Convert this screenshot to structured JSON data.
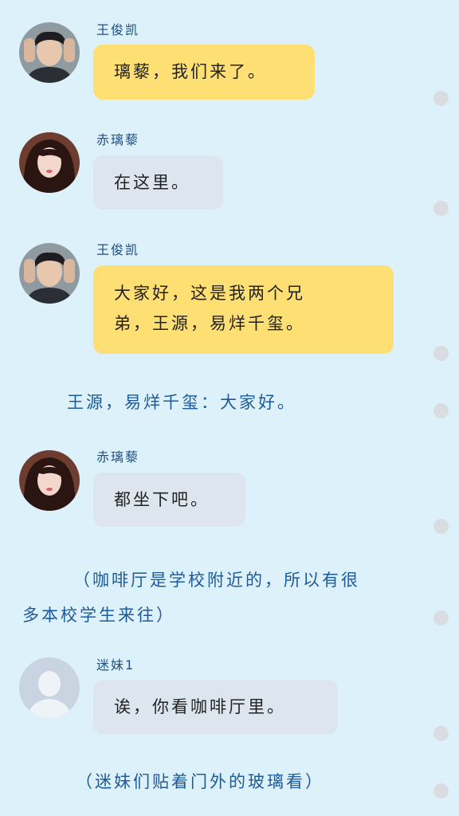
{
  "messages": [
    {
      "name": "王俊凯",
      "text": "璃藜，我们来了。",
      "avatar": "male-avatar"
    },
    {
      "name": "赤璃藜",
      "text": "在这里。",
      "avatar": "female-avatar"
    },
    {
      "name": "王俊凯",
      "text_line1": "大家好，这是我两个兄",
      "text_line2": "弟，王源，易烊千玺。",
      "avatar": "male-avatar"
    },
    {
      "name": "赤璃藜",
      "text": "都坐下吧。",
      "avatar": "female-avatar"
    },
    {
      "name": "迷妹1",
      "text": "诶，你看咖啡厅里。",
      "avatar": "default-avatar"
    }
  ],
  "narration": {
    "greeting": "王源，易烊千玺：大家好。",
    "cafe_line1": "（咖啡厅是学校附近的，所以有很",
    "cafe_line2": "多本校学生来往）",
    "window": "（迷妹们贴着门外的玻璃看）"
  },
  "colors": {
    "background": "#ddf1fa",
    "bubble_yellow": "#fedf74",
    "bubble_gray": "#dde6ee",
    "name": "#1f4f83",
    "narration": "#1c5a9a"
  }
}
